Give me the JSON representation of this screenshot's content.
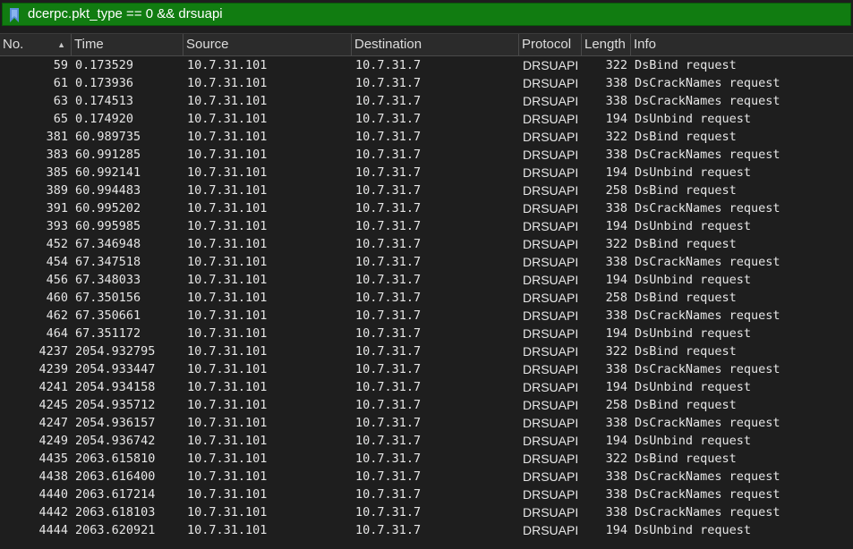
{
  "filter": {
    "value": "dcerpc.pkt_type == 0 && drsuapi"
  },
  "columns": {
    "no": "No.",
    "time": "Time",
    "source": "Source",
    "destination": "Destination",
    "protocol": "Protocol",
    "length": "Length",
    "info": "Info"
  },
  "colors": {
    "filter_valid_bg": "#117c11",
    "background": "#1e1e1e",
    "text": "#e6e6e6"
  },
  "packets": [
    {
      "no": "59",
      "time": "0.173529",
      "source": "10.7.31.101",
      "destination": "10.7.31.7",
      "protocol": "DRSUAPI",
      "length": "322",
      "info": "DsBind request"
    },
    {
      "no": "61",
      "time": "0.173936",
      "source": "10.7.31.101",
      "destination": "10.7.31.7",
      "protocol": "DRSUAPI",
      "length": "338",
      "info": "DsCrackNames request"
    },
    {
      "no": "63",
      "time": "0.174513",
      "source": "10.7.31.101",
      "destination": "10.7.31.7",
      "protocol": "DRSUAPI",
      "length": "338",
      "info": "DsCrackNames request"
    },
    {
      "no": "65",
      "time": "0.174920",
      "source": "10.7.31.101",
      "destination": "10.7.31.7",
      "protocol": "DRSUAPI",
      "length": "194",
      "info": "DsUnbind request"
    },
    {
      "no": "381",
      "time": "60.989735",
      "source": "10.7.31.101",
      "destination": "10.7.31.7",
      "protocol": "DRSUAPI",
      "length": "322",
      "info": "DsBind request"
    },
    {
      "no": "383",
      "time": "60.991285",
      "source": "10.7.31.101",
      "destination": "10.7.31.7",
      "protocol": "DRSUAPI",
      "length": "338",
      "info": "DsCrackNames request"
    },
    {
      "no": "385",
      "time": "60.992141",
      "source": "10.7.31.101",
      "destination": "10.7.31.7",
      "protocol": "DRSUAPI",
      "length": "194",
      "info": "DsUnbind request"
    },
    {
      "no": "389",
      "time": "60.994483",
      "source": "10.7.31.101",
      "destination": "10.7.31.7",
      "protocol": "DRSUAPI",
      "length": "258",
      "info": "DsBind request"
    },
    {
      "no": "391",
      "time": "60.995202",
      "source": "10.7.31.101",
      "destination": "10.7.31.7",
      "protocol": "DRSUAPI",
      "length": "338",
      "info": "DsCrackNames request"
    },
    {
      "no": "393",
      "time": "60.995985",
      "source": "10.7.31.101",
      "destination": "10.7.31.7",
      "protocol": "DRSUAPI",
      "length": "194",
      "info": "DsUnbind request"
    },
    {
      "no": "452",
      "time": "67.346948",
      "source": "10.7.31.101",
      "destination": "10.7.31.7",
      "protocol": "DRSUAPI",
      "length": "322",
      "info": "DsBind request"
    },
    {
      "no": "454",
      "time": "67.347518",
      "source": "10.7.31.101",
      "destination": "10.7.31.7",
      "protocol": "DRSUAPI",
      "length": "338",
      "info": "DsCrackNames request"
    },
    {
      "no": "456",
      "time": "67.348033",
      "source": "10.7.31.101",
      "destination": "10.7.31.7",
      "protocol": "DRSUAPI",
      "length": "194",
      "info": "DsUnbind request"
    },
    {
      "no": "460",
      "time": "67.350156",
      "source": "10.7.31.101",
      "destination": "10.7.31.7",
      "protocol": "DRSUAPI",
      "length": "258",
      "info": "DsBind request"
    },
    {
      "no": "462",
      "time": "67.350661",
      "source": "10.7.31.101",
      "destination": "10.7.31.7",
      "protocol": "DRSUAPI",
      "length": "338",
      "info": "DsCrackNames request"
    },
    {
      "no": "464",
      "time": "67.351172",
      "source": "10.7.31.101",
      "destination": "10.7.31.7",
      "protocol": "DRSUAPI",
      "length": "194",
      "info": "DsUnbind request"
    },
    {
      "no": "4237",
      "time": "2054.932795",
      "source": "10.7.31.101",
      "destination": "10.7.31.7",
      "protocol": "DRSUAPI",
      "length": "322",
      "info": "DsBind request"
    },
    {
      "no": "4239",
      "time": "2054.933447",
      "source": "10.7.31.101",
      "destination": "10.7.31.7",
      "protocol": "DRSUAPI",
      "length": "338",
      "info": "DsCrackNames request"
    },
    {
      "no": "4241",
      "time": "2054.934158",
      "source": "10.7.31.101",
      "destination": "10.7.31.7",
      "protocol": "DRSUAPI",
      "length": "194",
      "info": "DsUnbind request"
    },
    {
      "no": "4245",
      "time": "2054.935712",
      "source": "10.7.31.101",
      "destination": "10.7.31.7",
      "protocol": "DRSUAPI",
      "length": "258",
      "info": "DsBind request"
    },
    {
      "no": "4247",
      "time": "2054.936157",
      "source": "10.7.31.101",
      "destination": "10.7.31.7",
      "protocol": "DRSUAPI",
      "length": "338",
      "info": "DsCrackNames request"
    },
    {
      "no": "4249",
      "time": "2054.936742",
      "source": "10.7.31.101",
      "destination": "10.7.31.7",
      "protocol": "DRSUAPI",
      "length": "194",
      "info": "DsUnbind request"
    },
    {
      "no": "4435",
      "time": "2063.615810",
      "source": "10.7.31.101",
      "destination": "10.7.31.7",
      "protocol": "DRSUAPI",
      "length": "322",
      "info": "DsBind request"
    },
    {
      "no": "4438",
      "time": "2063.616400",
      "source": "10.7.31.101",
      "destination": "10.7.31.7",
      "protocol": "DRSUAPI",
      "length": "338",
      "info": "DsCrackNames request"
    },
    {
      "no": "4440",
      "time": "2063.617214",
      "source": "10.7.31.101",
      "destination": "10.7.31.7",
      "protocol": "DRSUAPI",
      "length": "338",
      "info": "DsCrackNames request"
    },
    {
      "no": "4442",
      "time": "2063.618103",
      "source": "10.7.31.101",
      "destination": "10.7.31.7",
      "protocol": "DRSUAPI",
      "length": "338",
      "info": "DsCrackNames request"
    },
    {
      "no": "4444",
      "time": "2063.620921",
      "source": "10.7.31.101",
      "destination": "10.7.31.7",
      "protocol": "DRSUAPI",
      "length": "194",
      "info": "DsUnbind request"
    }
  ]
}
